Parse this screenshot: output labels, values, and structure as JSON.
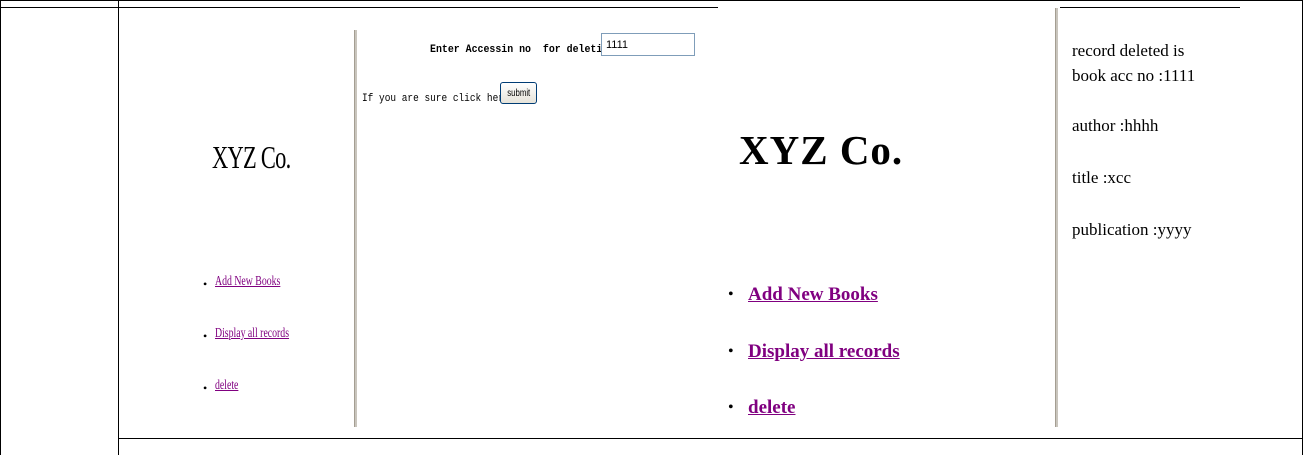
{
  "left_panel": {
    "logo": "XYZ Co.",
    "nav": [
      "Add New Books",
      "Display all records",
      "delete"
    ]
  },
  "delete_form": {
    "label": "Enter Accessin no  for deletion:",
    "acc_value": "1111",
    "confirm_label": "If you are sure click here",
    "submit_label": "submit"
  },
  "right_frame": {
    "logo": "XYZ Co.",
    "nav": [
      "Add New Books",
      "Display all records",
      "delete"
    ]
  },
  "result": {
    "line1": "record deleted is",
    "line2": "book acc no :1111",
    "author": "author :hhhh",
    "title": "title :xcc",
    "publication": "publication :yyyy"
  },
  "colors": {
    "visited_link": "#800080",
    "frame_separator": "#c9c5bd"
  }
}
